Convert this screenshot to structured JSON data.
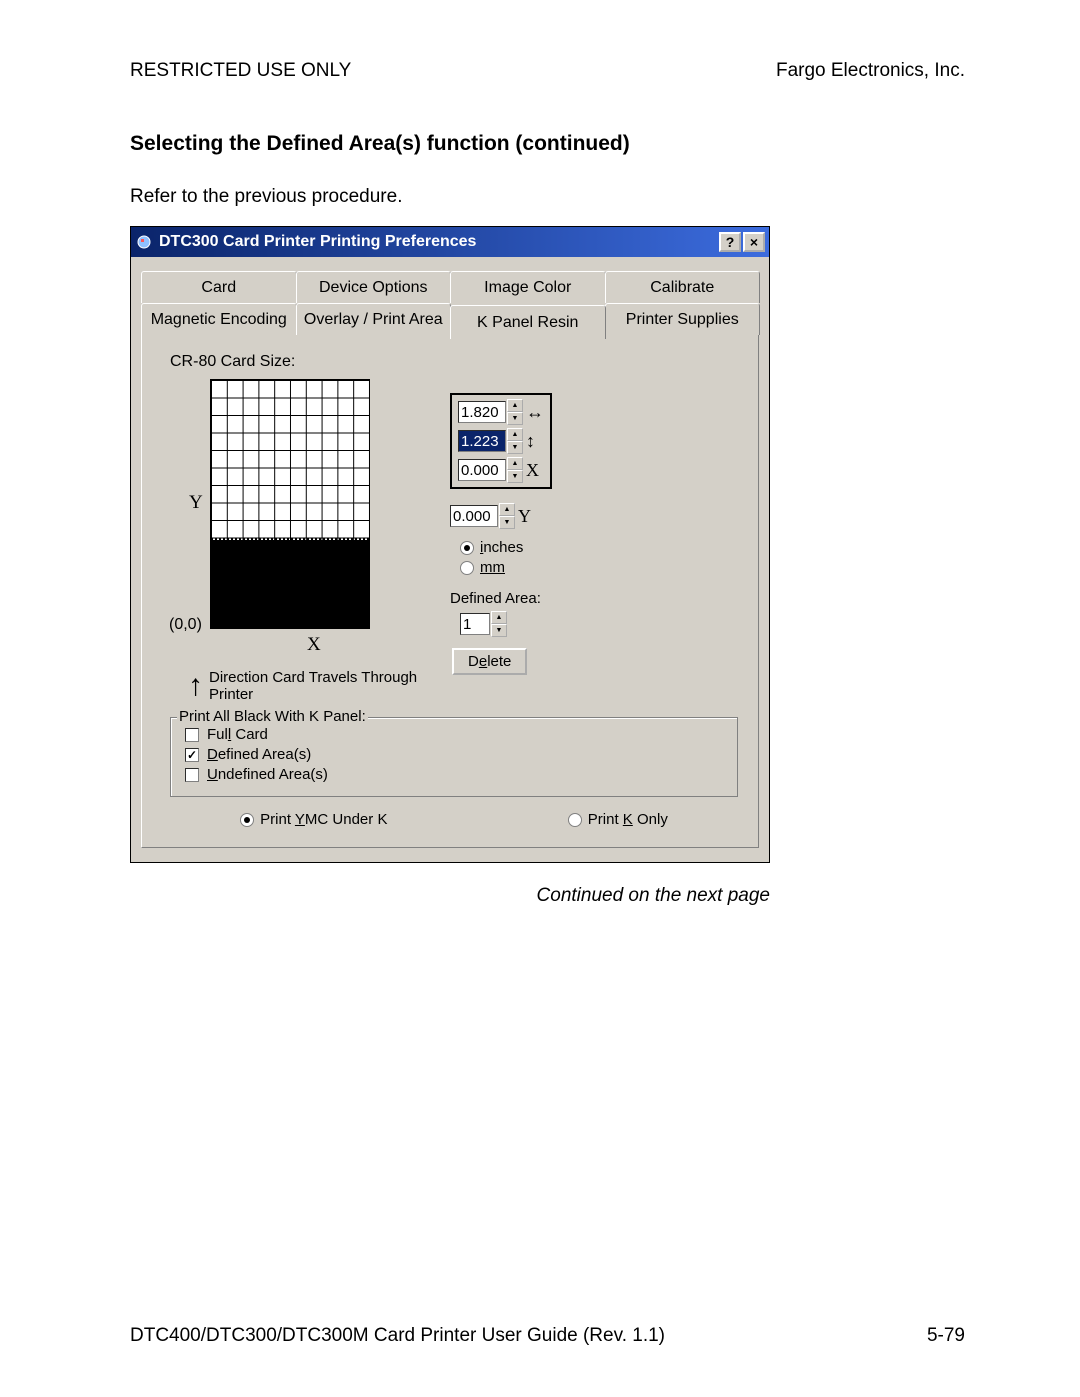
{
  "header": {
    "left": "RESTRICTED USE ONLY",
    "right": "Fargo Electronics, Inc."
  },
  "section_title": "Selecting the Defined Area(s) function (continued)",
  "intro": "Refer to the previous procedure.",
  "dialog": {
    "title": "DTC300 Card Printer Printing Preferences",
    "help_btn": "?",
    "close_btn": "×",
    "tabs_back": [
      "Card",
      "Device Options",
      "Image Color",
      "Calibrate"
    ],
    "tabs_front": [
      "Magnetic Encoding",
      "Overlay / Print Area",
      "K Panel Resin",
      "Printer Supplies"
    ],
    "selected_tab": "K Panel Resin",
    "card_size_label": "CR-80 Card Size:",
    "y_axis": "Y",
    "origin": "(0,0)",
    "x_axis": "X",
    "direction_text": "Direction Card Travels Through Printer",
    "dims": {
      "w": "1.820",
      "h": "1.223",
      "x": "0.000"
    },
    "y_value": "0.000",
    "units": {
      "inches": "inches",
      "mm": "mm",
      "selected": "inches"
    },
    "defined_area_label": "Defined Area:",
    "defined_area_value": "1",
    "delete_label": "Delete",
    "panel": {
      "legend": "Print All Black With K Panel:",
      "full_card": "Full Card",
      "defined": "Defined Area(s)",
      "undefined": "Undefined Area(s)",
      "defined_checked": true
    },
    "print_opts": {
      "ymc": "Print YMC Under K",
      "konly": "Print K Only",
      "selected": "ymc"
    }
  },
  "continued": "Continued on the next page",
  "footer": {
    "left": "DTC400/DTC300/DTC300M Card Printer User Guide (Rev. 1.1)",
    "right": "5-79"
  }
}
